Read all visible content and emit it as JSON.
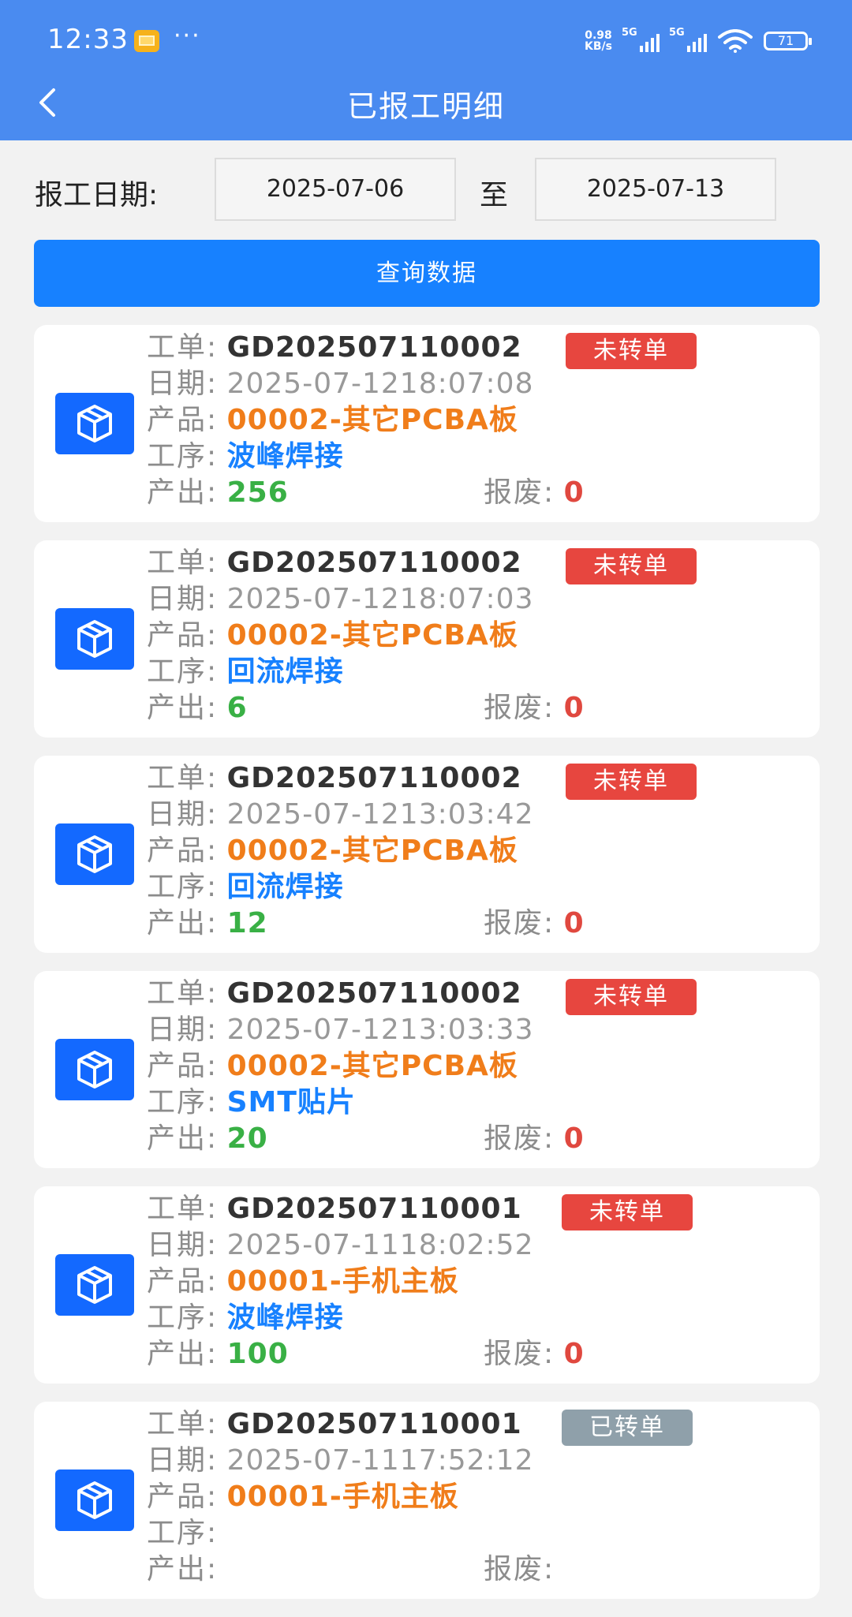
{
  "status_bar": {
    "time": "12:33",
    "more": "···",
    "speed_top": "0.98",
    "speed_bottom": "KB/s",
    "sig1_label": "5G",
    "sig2_label": "5G",
    "battery": "71"
  },
  "header": {
    "title": "已报工明细",
    "back_icon": "chevron-left-icon"
  },
  "filter": {
    "label": "报工日期:",
    "date_from": "2025-07-06",
    "to_label": "至",
    "date_to": "2025-07-13",
    "query_button": "查询数据"
  },
  "labels": {
    "order": "工单:",
    "date": "日期:",
    "product": "产品:",
    "process": "工序:",
    "output": "产出:",
    "scrap": "报废:"
  },
  "colors": {
    "header_bg": "#4a8bf0",
    "button_bg": "#1781ff",
    "icon_bg": "#1369ff",
    "badge_pending": "#e7463f",
    "badge_done": "#8fa0aa",
    "product": "#f07d1a",
    "process": "#1781ff",
    "output": "#39b045",
    "scrap": "#e0483f"
  },
  "records": [
    {
      "order": "GD202507110002",
      "status": "未转单",
      "status_type": "pending",
      "date": "2025-07-1218:07:08",
      "product": "00002-其它PCBA板",
      "process": "波峰焊接",
      "output": "256",
      "scrap": "0"
    },
    {
      "order": "GD202507110002",
      "status": "未转单",
      "status_type": "pending",
      "date": "2025-07-1218:07:03",
      "product": "00002-其它PCBA板",
      "process": "回流焊接",
      "output": "6",
      "scrap": "0"
    },
    {
      "order": "GD202507110002",
      "status": "未转单",
      "status_type": "pending",
      "date": "2025-07-1213:03:42",
      "product": "00002-其它PCBA板",
      "process": "回流焊接",
      "output": "12",
      "scrap": "0"
    },
    {
      "order": "GD202507110002",
      "status": "未转单",
      "status_type": "pending",
      "date": "2025-07-1213:03:33",
      "product": "00002-其它PCBA板",
      "process": "SMT贴片",
      "output": "20",
      "scrap": "0"
    },
    {
      "order": "GD202507110001",
      "status": "未转单",
      "status_type": "pending",
      "date": "2025-07-1118:02:52",
      "product": "00001-手机主板",
      "process": "波峰焊接",
      "output": "100",
      "scrap": "0"
    },
    {
      "order": "GD202507110001",
      "status": "已转单",
      "status_type": "done",
      "date": "2025-07-1117:52:12",
      "product": "00001-手机主板",
      "process": "",
      "output": "",
      "scrap": ""
    }
  ]
}
